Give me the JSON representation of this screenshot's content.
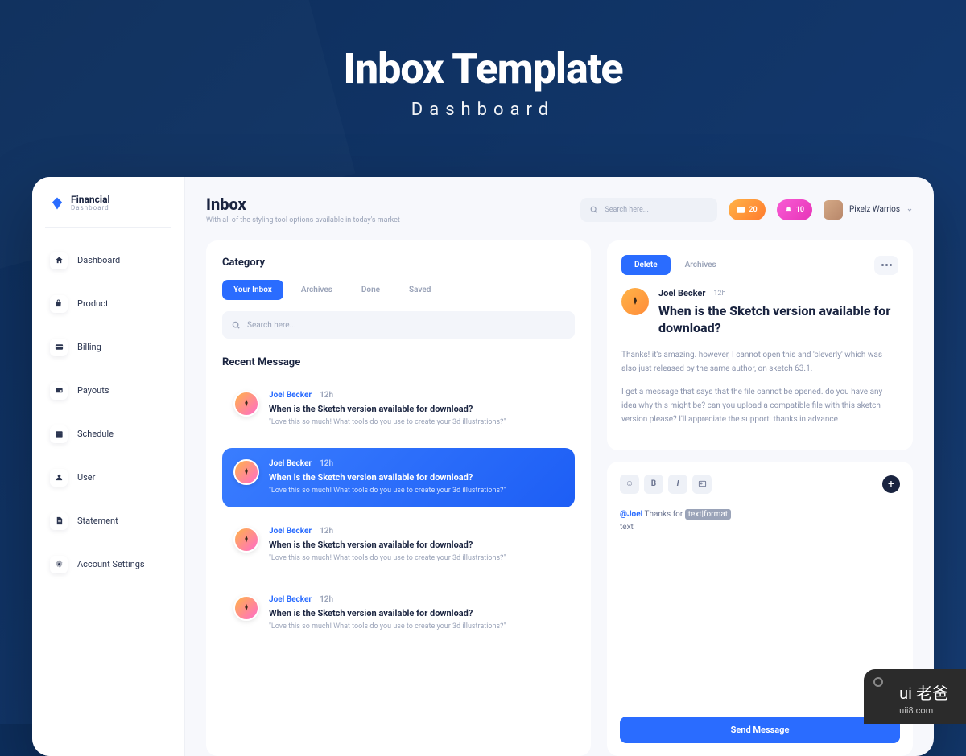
{
  "hero": {
    "title": "Inbox Template",
    "subtitle": "Dashboard"
  },
  "brand": {
    "name": "Financial",
    "sub": "Dashboard"
  },
  "nav": [
    {
      "label": "Dashboard",
      "icon": "home"
    },
    {
      "label": "Product",
      "icon": "bag"
    },
    {
      "label": "Billing",
      "icon": "card"
    },
    {
      "label": "Payouts",
      "icon": "wallet"
    },
    {
      "label": "Schedule",
      "icon": "calendar"
    },
    {
      "label": "User",
      "icon": "user"
    },
    {
      "label": "Statement",
      "icon": "doc"
    },
    {
      "label": "Account Settings",
      "icon": "gear"
    }
  ],
  "page": {
    "title": "Inbox",
    "subtitle": "With all of the styling tool options available in today's market"
  },
  "search": {
    "placeholder": "Search here..."
  },
  "badges": {
    "mail": "20",
    "bell": "10"
  },
  "user": {
    "name": "Pixelz Warrios"
  },
  "category": {
    "title": "Category",
    "tabs": [
      "Your Inbox",
      "Archives",
      "Done",
      "Saved"
    ],
    "search_placeholder": "Search here..."
  },
  "recent": {
    "title": "Recent Message",
    "items": [
      {
        "name": "Joel Becker",
        "time": "12h",
        "subject": "When is the Sketch version available for download?",
        "preview": "\"Love this so much! What tools do you use to create your 3d illustrations?\"",
        "selected": false
      },
      {
        "name": "Joel Becker",
        "time": "12h",
        "subject": "When is the Sketch version available for download?",
        "preview": "\"Love this so much! What tools do you use to create your 3d illustrations?\"",
        "selected": true
      },
      {
        "name": "Joel Becker",
        "time": "12h",
        "subject": "When is the Sketch version available for download?",
        "preview": "\"Love this so much! What tools do you use to create your 3d illustrations?\"",
        "selected": false
      },
      {
        "name": "Joel Becker",
        "time": "12h",
        "subject": "When is the Sketch version available for download?",
        "preview": "\"Love this so much! What tools do you use to create your 3d illustrations?\"",
        "selected": false
      }
    ]
  },
  "detail": {
    "actions": {
      "delete": "Delete",
      "archives": "Archives"
    },
    "name": "Joel Becker",
    "time": "12h",
    "subject": "When is the Sketch version available for download?",
    "p1": "Thanks! it's amazing. however, I cannot open this and 'cleverly' which was also just released by the same author, on sketch 63.1.",
    "p2": "I get a message that says that the file cannot be opened. do you have any idea why this might be? can you upload a compatible file with this sketch version please? I'll appreciate the support. thanks in advance"
  },
  "compose": {
    "mention": "@Joel",
    "text1": "Thanks for",
    "highlight": "text|format",
    "text2": "text",
    "send": "Send Message"
  },
  "watermark": {
    "top": "ui 老爸",
    "bottom": "uii8.com"
  }
}
